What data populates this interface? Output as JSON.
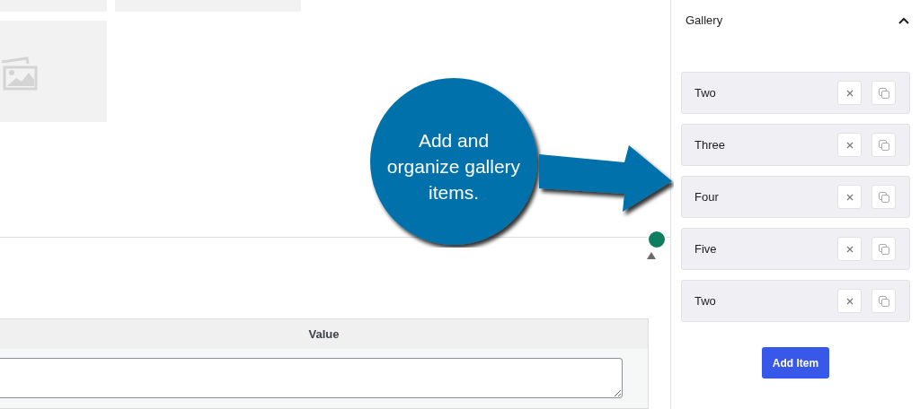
{
  "callout": {
    "text": "Add and organize gallery items."
  },
  "table": {
    "columns": [
      "Value"
    ]
  },
  "gallery_panel": {
    "title": "Gallery",
    "expanded": true,
    "items": [
      {
        "label": "Two"
      },
      {
        "label": "Three"
      },
      {
        "label": "Four"
      },
      {
        "label": "Five"
      },
      {
        "label": "Two"
      }
    ],
    "add_button": "Add Item"
  }
}
